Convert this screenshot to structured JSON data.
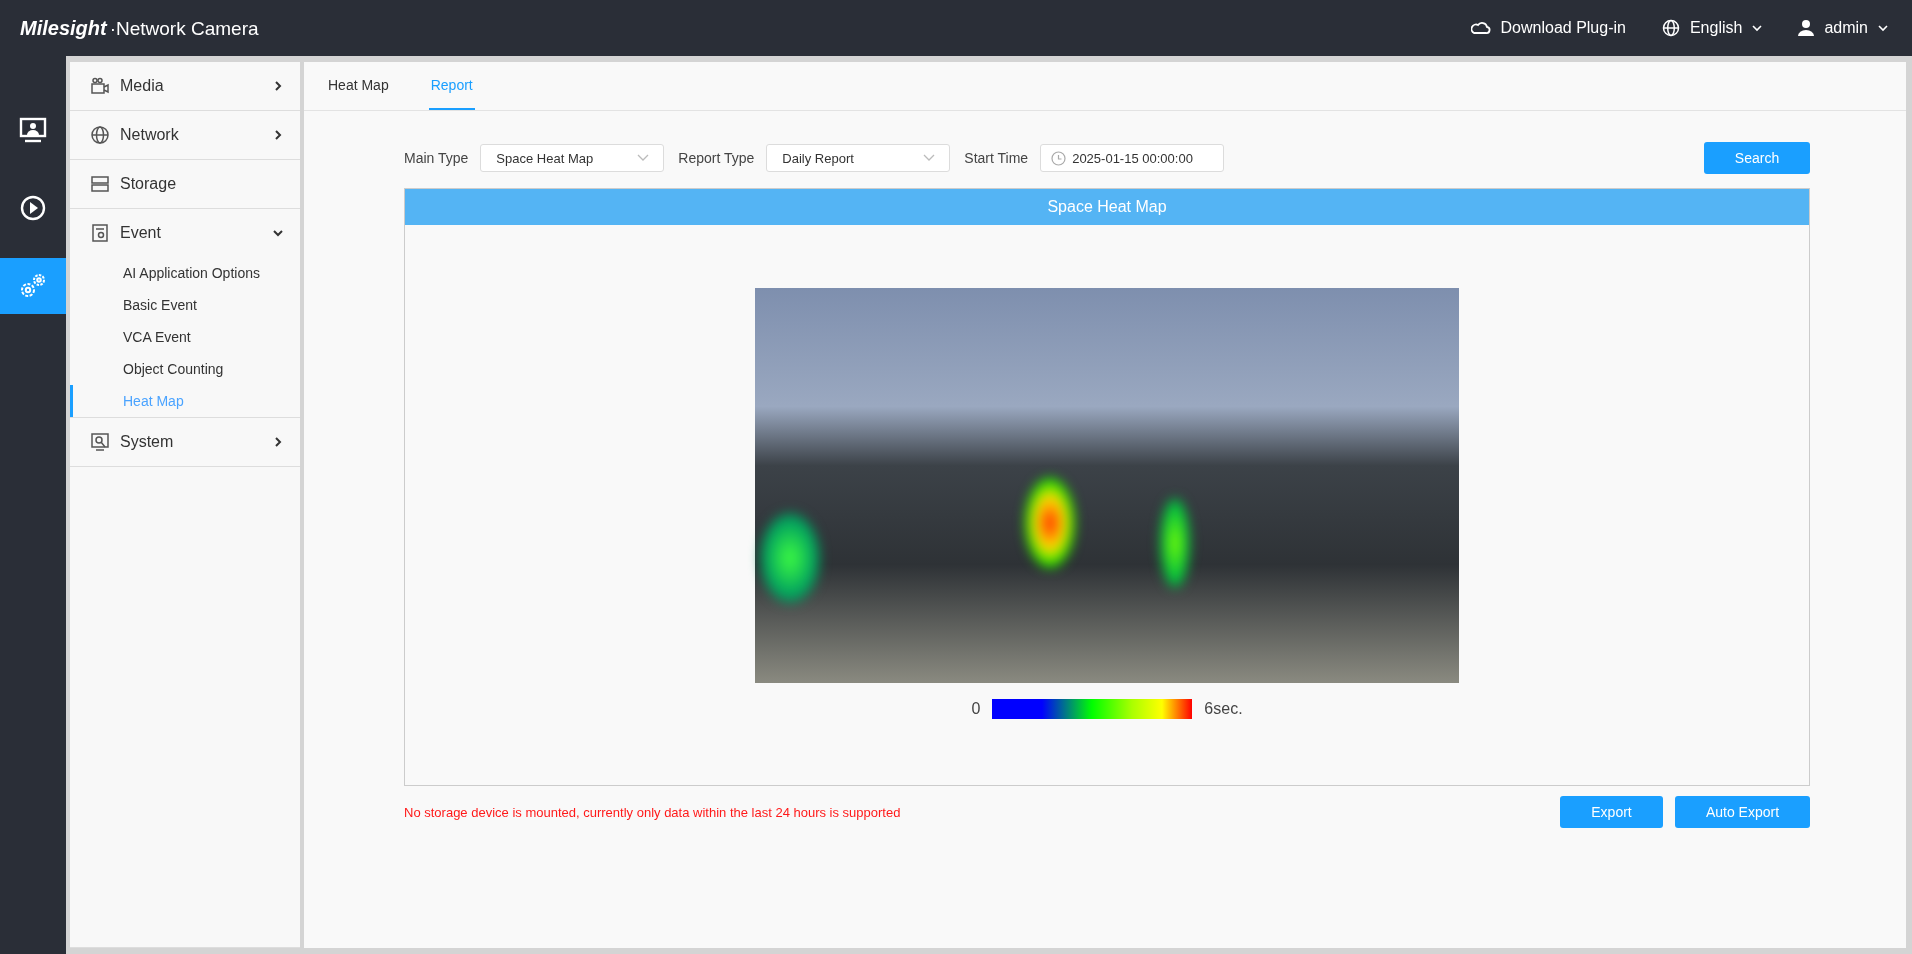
{
  "header": {
    "brand": "Milesight",
    "product": "·Network Camera",
    "actions": [
      {
        "kind": "plugin",
        "label": "Download Plug-in"
      },
      {
        "kind": "language",
        "label": "English"
      },
      {
        "kind": "user",
        "label": "admin"
      }
    ]
  },
  "rail": [
    {
      "kind": "live",
      "selected": false
    },
    {
      "kind": "playback",
      "selected": false
    },
    {
      "kind": "settings",
      "selected": true
    }
  ],
  "sidebar": {
    "items": [
      {
        "kind": "media",
        "label": "Media",
        "expandable": true,
        "expanded": false
      },
      {
        "kind": "network",
        "label": "Network",
        "expandable": true,
        "expanded": false
      },
      {
        "kind": "storage",
        "label": "Storage",
        "expandable": false,
        "expanded": false
      },
      {
        "kind": "event",
        "label": "Event",
        "expandable": true,
        "expanded": true,
        "children": [
          {
            "label": "AI Application Options",
            "selected": false
          },
          {
            "label": "Basic Event",
            "selected": false
          },
          {
            "label": "VCA Event",
            "selected": false
          },
          {
            "label": "Object Counting",
            "selected": false
          },
          {
            "label": "Heat Map",
            "selected": true
          }
        ]
      },
      {
        "kind": "system",
        "label": "System",
        "expandable": true,
        "expanded": false
      }
    ]
  },
  "tabs": [
    {
      "label": "Heat Map",
      "selected": false
    },
    {
      "label": "Report",
      "selected": true
    }
  ],
  "filters": {
    "main_type": {
      "label": "Main Type",
      "value": "Space Heat Map"
    },
    "report_type": {
      "label": "Report Type",
      "value": "Daily Report"
    },
    "start_time": {
      "label": "Start Time",
      "value": "2025-01-15 00:00:00"
    },
    "search": "Search"
  },
  "panel": {
    "title": "Space Heat Map",
    "legend": {
      "min": "0",
      "max": "6sec."
    }
  },
  "warning": "No storage device is mounted, currently only data within the last 24 hours is supported",
  "buttons": [
    "Export",
    "Auto Export"
  ]
}
